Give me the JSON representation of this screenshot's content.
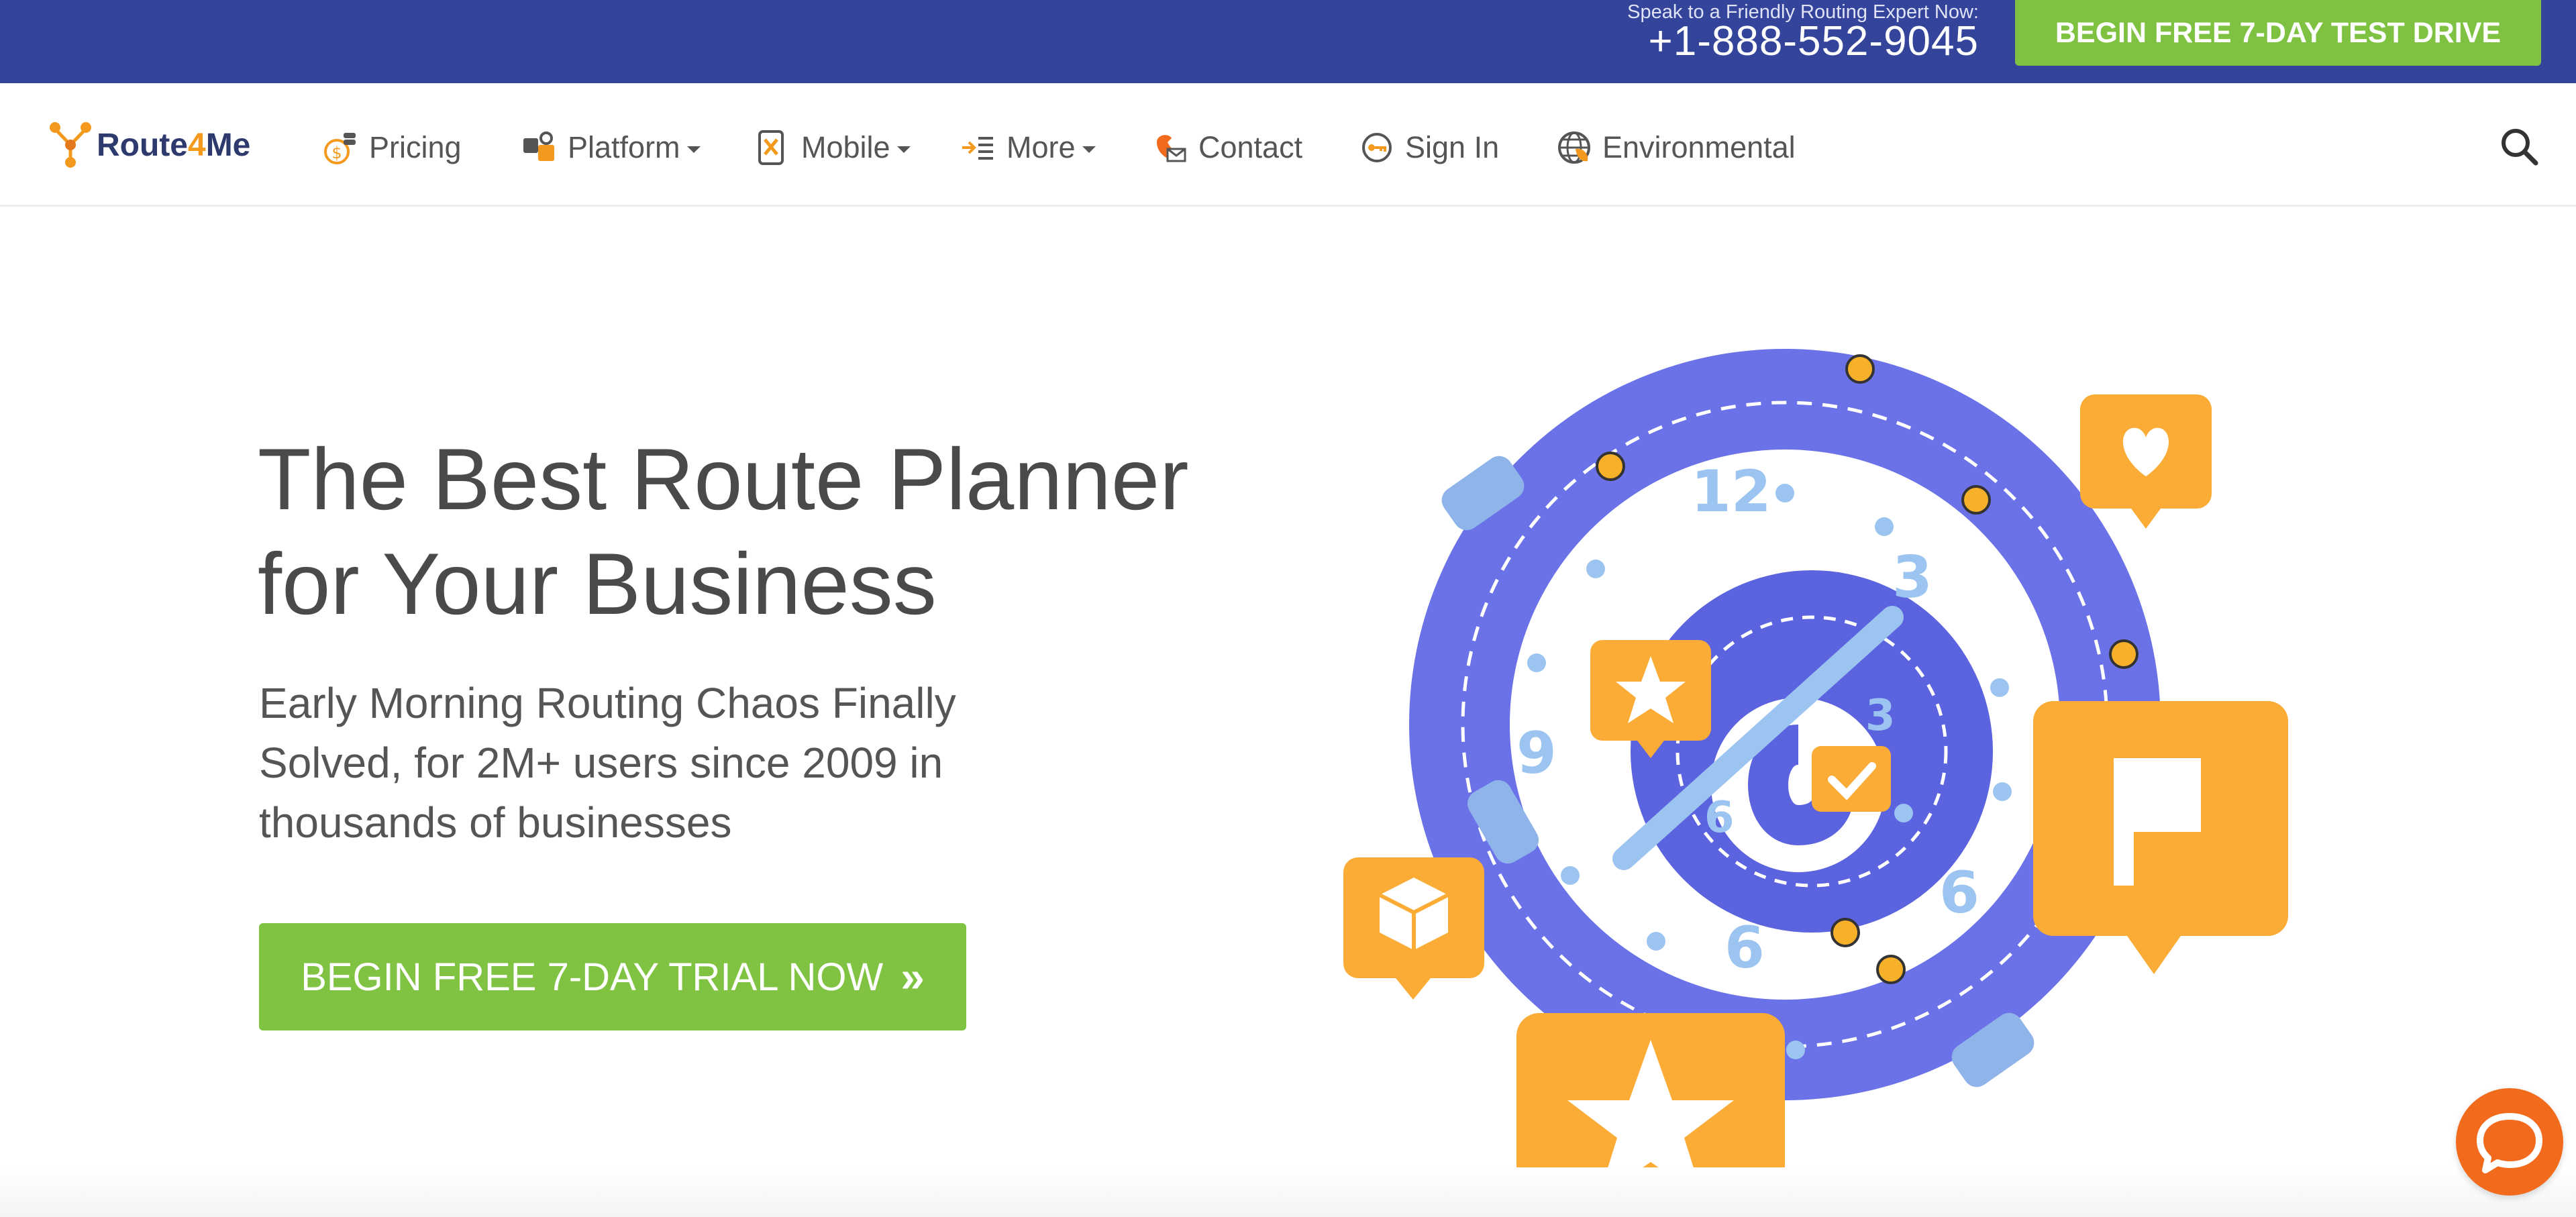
{
  "topbar": {
    "speak_label": "Speak to a Friendly Routing Expert Now:",
    "phone": "+1-888-552-9045",
    "test_drive_label": "BEGIN FREE 7-DAY TEST DRIVE"
  },
  "nav": {
    "logo_prefix": "Route",
    "logo_four": "4",
    "logo_suffix": "Me",
    "items": [
      {
        "label": "Pricing",
        "icon": "pricing-icon",
        "dropdown": false
      },
      {
        "label": "Platform",
        "icon": "platform-icon",
        "dropdown": true
      },
      {
        "label": "Mobile",
        "icon": "mobile-icon",
        "dropdown": true
      },
      {
        "label": "More",
        "icon": "more-icon",
        "dropdown": true
      },
      {
        "label": "Contact",
        "icon": "contact-icon",
        "dropdown": false
      },
      {
        "label": "Sign In",
        "icon": "key-icon",
        "dropdown": false
      },
      {
        "label": "Environmental",
        "icon": "globe-icon",
        "dropdown": false
      }
    ]
  },
  "hero": {
    "title_line1": "The Best Route Planner",
    "title_line2": "for Your Business",
    "subtitle_line1": "Early Morning Routing Chaos Finally",
    "subtitle_line2": "Solved, for 2M+ users since 2009 in",
    "subtitle_line3": "thousands of businesses",
    "cta_label": "BEGIN FREE 7-DAY TRIAL NOW",
    "cta_chevron": "»"
  },
  "illustration": {
    "clock_numbers": [
      "12",
      "3",
      "9",
      "6",
      "6",
      "3",
      "6"
    ]
  },
  "colors": {
    "topbar": "#33449a",
    "accent_green": "#80c342",
    "ring": "#6b72e8",
    "clock_number": "#9cc4f0",
    "badge_orange": "#fbac36",
    "chat": "#f26a1b"
  }
}
